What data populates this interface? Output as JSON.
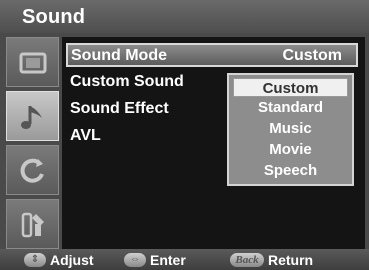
{
  "title": "Sound",
  "menu": [
    {
      "label": "Sound Mode",
      "value": "Custom"
    },
    {
      "label": "Custom Sound",
      "value": ""
    },
    {
      "label": "Sound Effect",
      "value": ""
    },
    {
      "label": "AVL",
      "value": ""
    }
  ],
  "sidebar": {
    "items": [
      {
        "icon": "picture-icon"
      },
      {
        "icon": "music-note-icon"
      },
      {
        "icon": "channel-icon"
      },
      {
        "icon": "tools-icon"
      }
    ]
  },
  "dropdown": {
    "options": [
      "Custom",
      "Standard",
      "Music",
      "Movie",
      "Speech"
    ],
    "selected": "Custom"
  },
  "footer": {
    "adjust_icon": "up-down-icon",
    "adjust_label": "Adjust",
    "enter_icon": "left-right-icon",
    "enter_label": "Enter",
    "back_icon_text": "Back",
    "return_label": "Return"
  }
}
